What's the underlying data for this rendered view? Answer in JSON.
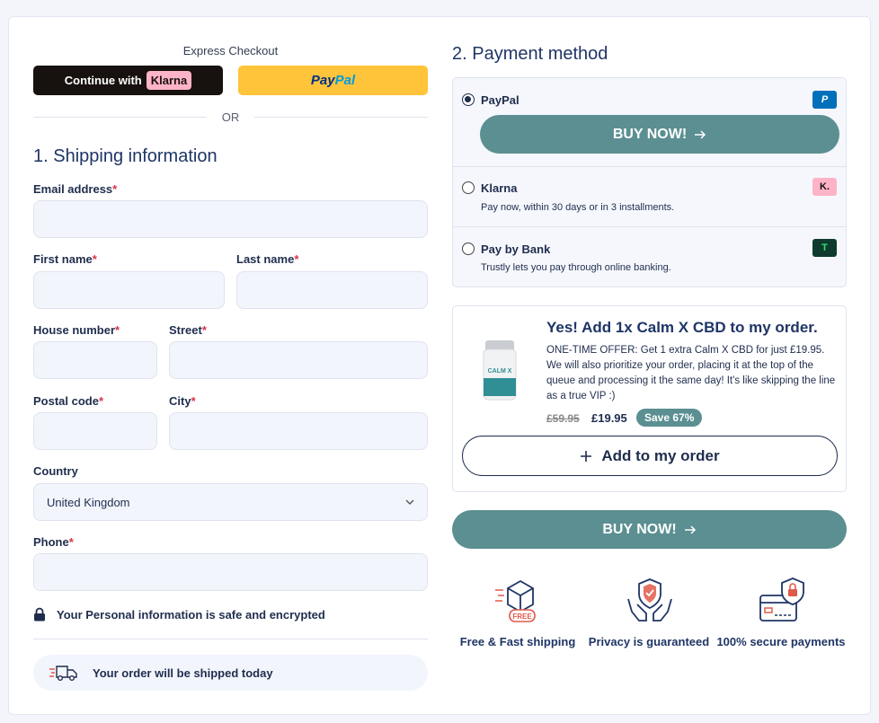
{
  "express": {
    "title": "Express Checkout",
    "klarna_prefix": "Continue with",
    "klarna_brand": "Klarna",
    "paypal_a": "Pay",
    "paypal_b": "Pal",
    "or": "OR"
  },
  "shipping": {
    "heading": "1. Shipping information",
    "email_label": "Email address",
    "first_name_label": "First name",
    "last_name_label": "Last name",
    "house_label": "House number",
    "street_label": "Street",
    "postal_label": "Postal code",
    "city_label": "City",
    "country_label": "Country",
    "country_value": "United Kingdom",
    "phone_label": "Phone",
    "required_mark": "*",
    "secure_note": "Your Personal information is safe and encrypted",
    "ship_note": "Your order will be shipped today"
  },
  "payment": {
    "heading": "2. Payment method",
    "options": [
      {
        "name": "PayPal",
        "desc": "",
        "selected": true,
        "logo": "P"
      },
      {
        "name": "Klarna",
        "desc": "Pay now, within 30 days or in 3 installments.",
        "selected": false,
        "logo": "K."
      },
      {
        "name": "Pay by Bank",
        "desc": "Trustly lets you pay through online banking.",
        "selected": false,
        "logo": "T"
      }
    ],
    "buy_label": "BUY NOW!"
  },
  "upsell": {
    "title": "Yes! Add 1x Calm X CBD to my order.",
    "text": "ONE-TIME OFFER: Get 1 extra Calm X CBD for just £19.95. We will also prioritize your order, placing it at the top of the queue and processing it the same day! It's like skipping the line as a true VIP :)",
    "price_old": "£59.95",
    "price_new": "£19.95",
    "save": "Save 67%",
    "add_label": "Add to my order",
    "product_label": "CALM X"
  },
  "buy_main_label": "BUY NOW!",
  "trust": [
    {
      "label": "Free & Fast shipping",
      "icon": "free-shipping-box-icon",
      "badge": "FREE"
    },
    {
      "label": "Privacy is guaranteed",
      "icon": "shield-hands-icon"
    },
    {
      "label": "100% secure payments",
      "icon": "secure-card-icon"
    }
  ],
  "colors": {
    "accent": "#5b8f91",
    "navy": "#1f3566",
    "required": "#d6344a"
  }
}
